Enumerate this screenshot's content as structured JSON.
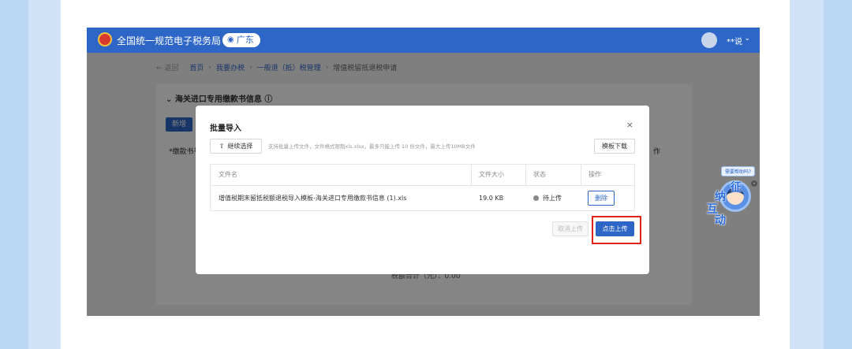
{
  "colors": {
    "brand": "#2e66c7",
    "highlight": "#e0231b"
  },
  "header": {
    "site_title": "全国统一规范电子税务局",
    "region": "广东",
    "user_name": "**说"
  },
  "breadcrumb": {
    "back": "返回",
    "items": [
      "首页",
      "我要办税",
      "一般退（抵）税管理",
      "增值税留抵退税申请"
    ]
  },
  "page": {
    "section_title": "海关进口专用缴款书信息",
    "add_button": "新增",
    "column_label": "*缴款书号",
    "column_label_right": "作",
    "summary": "税额合计（元）：0.00"
  },
  "dialog": {
    "title": "批量导入",
    "close": "×",
    "continue_button": "继续选择",
    "upload_hint": "支持批量上传文件，文件格式限制xls.xlsx，最多只能上传 10 份文件，最大上传10MB文件",
    "template_button": "模板下载",
    "columns": [
      "文件名",
      "文件大小",
      "状态",
      "操作"
    ],
    "rows": [
      {
        "file_name": "增值税期末留抵税额退税导入模板-海关进口专用缴款书信息 (1).xls",
        "size": "19.0 KB",
        "status": "待上传",
        "action": "删除"
      }
    ],
    "cancel_button": "取消上传",
    "upload_button": "点击上传"
  },
  "mascot": {
    "tooltip": "需要帮助吗?",
    "chars": [
      "征",
      "纳",
      "互",
      "动"
    ],
    "close": "-"
  }
}
